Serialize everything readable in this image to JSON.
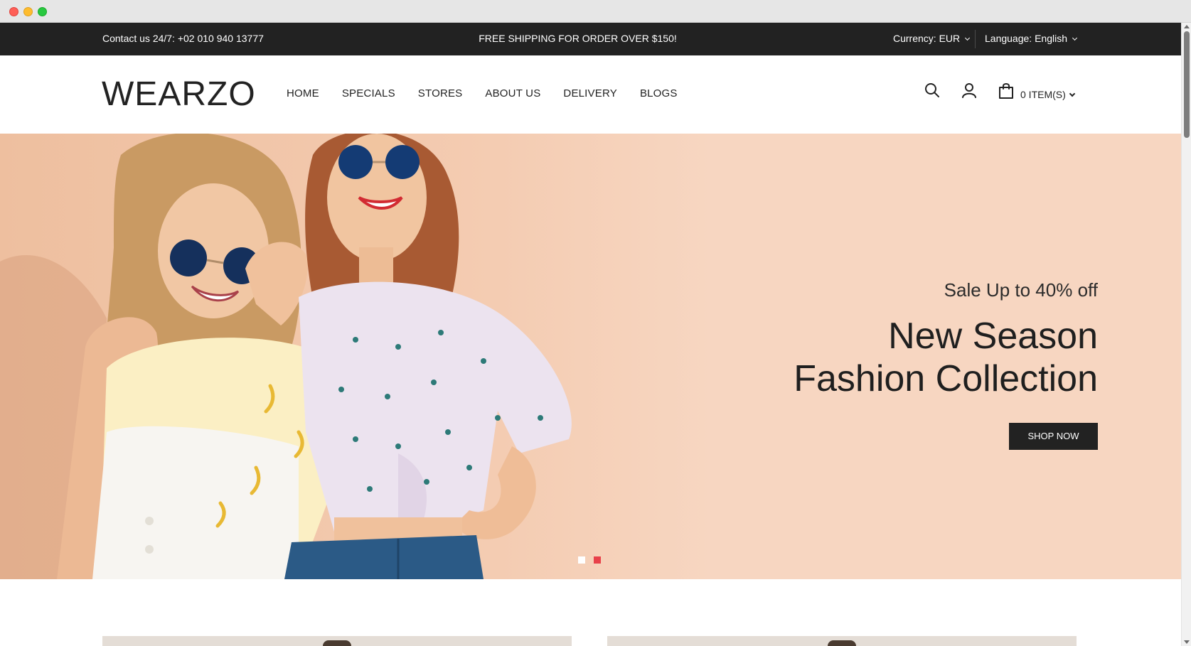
{
  "topbar": {
    "contact": "Contact us 24/7: +02 010 940 13777",
    "shipping": "FREE SHIPPING FOR ORDER OVER $150!",
    "currency": "Currency: EUR",
    "language": "Language: English"
  },
  "header": {
    "logo": "WEARZO",
    "nav": [
      "HOME",
      "SPECIALS",
      "STORES",
      "ABOUT US",
      "DELIVERY",
      "BLOGS"
    ],
    "cart": "0 ITEM(S)",
    "icons": [
      "search-icon",
      "user-icon",
      "cart-icon"
    ]
  },
  "hero": {
    "subtitle": "Sale Up to 40% off",
    "title_line1": "New Season",
    "title_line2": "Fashion Collection",
    "button": "SHOP NOW",
    "slides_total": 2,
    "active_slide": 2
  },
  "colors": {
    "topbar_bg": "#222222",
    "hero_bg": "#f7d6c1",
    "accent": "#e8414a",
    "button_bg": "#222222"
  }
}
